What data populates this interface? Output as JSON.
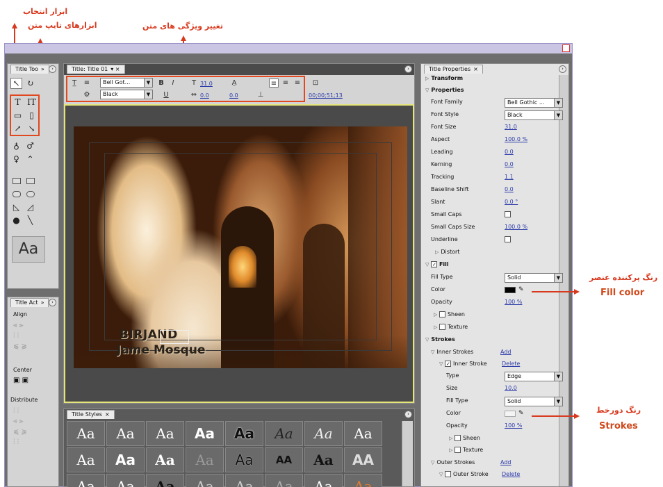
{
  "annotations": {
    "select_tool": "ابزار انتخاب",
    "type_tools": "ابزارهای تایپ متن",
    "text_properties": "تغییر ویژگی های متن",
    "fill_color_fa": "رنگ پرکننده عنصر",
    "fill_color_en": "Fill color",
    "strokes_fa": "رنگ دورخط",
    "strokes_en": "Strokes"
  },
  "tools_panel": {
    "tab": "Title Too"
  },
  "actions_panel": {
    "tab": "Title Act",
    "align": "Align",
    "center": "Center",
    "distribute": "Distribute"
  },
  "title_panel": {
    "tab": "Title: Title 01",
    "font_family": "Bell Got...",
    "font_style": "Black",
    "font_size": "31.0",
    "kerning": "0.0",
    "leading": "0.0",
    "timecode": "00;00;51;13",
    "text_line1": "BIRJAND",
    "text_line2": "Jame Mosque"
  },
  "styles_panel": {
    "tab": "Title Styles",
    "row1": [
      "Aa",
      "Aa",
      "Aa",
      "Aa",
      "Aa",
      "Aa",
      "Aa",
      "Aa"
    ],
    "row2": [
      "Aa",
      "Aa",
      "Aa",
      "Aa",
      "Aa",
      "AA",
      "Aa",
      "AA"
    ],
    "row3": [
      "Aa",
      "Aa",
      "Aa",
      "Aa",
      "Aa",
      "Aa",
      "Aa",
      "Aa"
    ]
  },
  "properties_panel": {
    "tab": "Title Properties",
    "transform": "Transform",
    "properties": "Properties",
    "rows": [
      {
        "label": "Font Family",
        "value": "Bell Gothic ..."
      },
      {
        "label": "Font Style",
        "value": "Black"
      },
      {
        "label": "Font Size",
        "value": "31.0"
      },
      {
        "label": "Aspect",
        "value": "100.0 %"
      },
      {
        "label": "Leading",
        "value": "0.0"
      },
      {
        "label": "Kerning",
        "value": "0.0"
      },
      {
        "label": "Tracking",
        "value": "1.1"
      },
      {
        "label": "Baseline Shift",
        "value": "0.0"
      },
      {
        "label": "Slant",
        "value": "0.0 °"
      },
      {
        "label": "Small Caps",
        "value": ""
      },
      {
        "label": "Small Caps Size",
        "value": "100.0 %"
      },
      {
        "label": "Underline",
        "value": ""
      }
    ],
    "distort": "Distort",
    "fill": "Fill",
    "fill_type_label": "Fill Type",
    "fill_type_value": "Solid",
    "color_label": "Color",
    "opacity_label": "Opacity",
    "opacity_value": "100 %",
    "sheen": "Sheen",
    "texture": "Texture",
    "strokes": "Strokes",
    "inner_strokes": "Inner Strokes",
    "add": "Add",
    "inner_stroke": "Inner Stroke",
    "delete": "Delete",
    "type_label": "Type",
    "type_value": "Edge",
    "size_label": "Size",
    "size_value": "10.0",
    "outer_strokes": "Outer Strokes",
    "outer_stroke": "Outer Stroke"
  }
}
